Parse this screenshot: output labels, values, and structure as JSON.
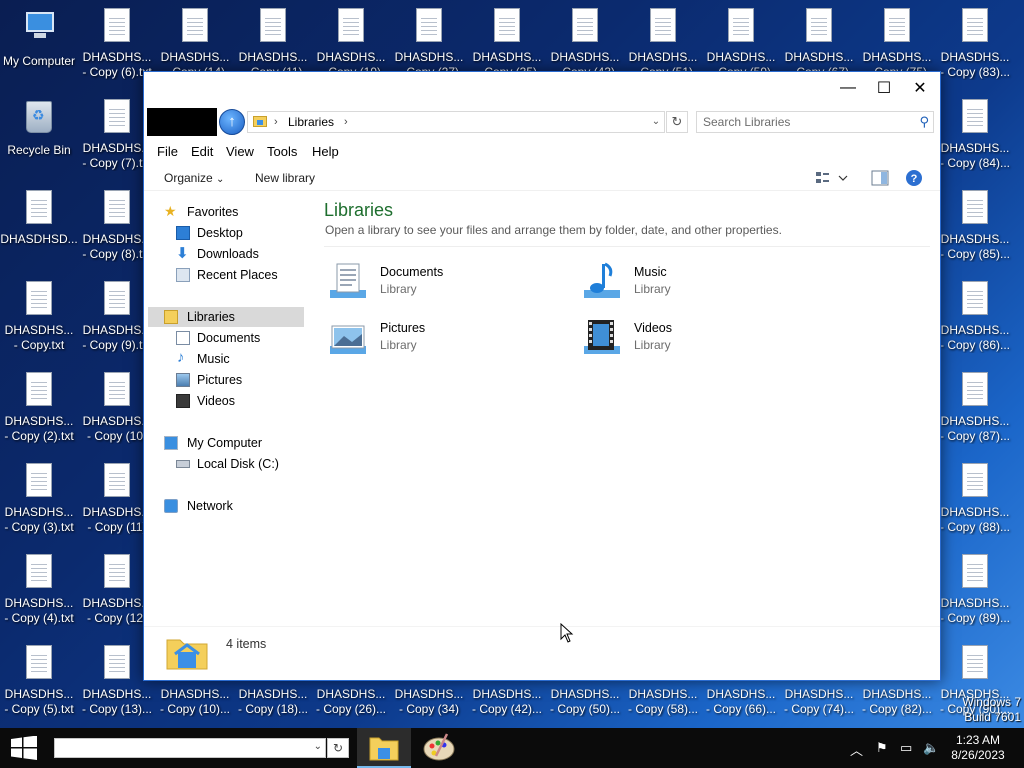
{
  "desktop": {
    "icons": [
      {
        "line1": "My Computer",
        "line2": ""
      },
      {
        "line1": "Recycle Bin",
        "line2": ""
      },
      {
        "line1": "DHASDHSD...",
        "line2": ""
      },
      {
        "line1": "DHASDHS...",
        "line2": "- Copy.txt"
      },
      {
        "line1": "DHASDHS...",
        "line2": "- Copy (2).txt"
      },
      {
        "line1": "DHASDHS...",
        "line2": "- Copy (3).txt"
      },
      {
        "line1": "DHASDHS...",
        "line2": "- Copy (4).txt"
      },
      {
        "line1": "DHASDHS...",
        "line2": "- Copy (5).txt"
      },
      {
        "line1": "DHASDHS...",
        "line2": "- Copy (6).txt"
      },
      {
        "line1": "DHASDHS...",
        "line2": "- Copy (7).txt"
      },
      {
        "line1": "DHASDHS...",
        "line2": "- Copy (8).txt"
      },
      {
        "line1": "DHASDHS...",
        "line2": "- Copy (9).txt"
      },
      {
        "line1": "DHASDHS...",
        "line2": "- Copy (10)"
      },
      {
        "line1": "DHASDHS...",
        "line2": "- Copy (11)"
      },
      {
        "line1": "DHASDHS...",
        "line2": "- Copy (12)"
      },
      {
        "line1": "DHASDHS...",
        "line2": "- Copy (13)..."
      },
      {
        "line1": "DHASDHS...",
        "line2": "- Copy (14)"
      },
      {
        "line1": "DHASDHS...",
        "line2": "- Copy (11)"
      },
      {
        "line1": "DHASDHS...",
        "line2": "- Copy (19)"
      },
      {
        "line1": "DHASDHS...",
        "line2": "- Copy (27)"
      },
      {
        "line1": "DHASDHS...",
        "line2": "- Copy (35)"
      },
      {
        "line1": "DHASDHS...",
        "line2": "- Copy (43)"
      },
      {
        "line1": "DHASDHS...",
        "line2": "- Copy (51)"
      },
      {
        "line1": "DHASDHS...",
        "line2": "- Copy (59)"
      },
      {
        "line1": "DHASDHS...",
        "line2": "- Copy (67)"
      },
      {
        "line1": "DHASDHS...",
        "line2": "- Copy (75)"
      },
      {
        "line1": "DHASDHS...",
        "line2": "- Copy (83)..."
      },
      {
        "line1": "DHASDHS...",
        "line2": "- Copy (84)..."
      },
      {
        "line1": "DHASDHS...",
        "line2": "- Copy (85)..."
      },
      {
        "line1": "DHASDHS...",
        "line2": "- Copy (86)..."
      },
      {
        "line1": "DHASDHS...",
        "line2": "- Copy (87)..."
      },
      {
        "line1": "DHASDHS...",
        "line2": "- Copy (88)..."
      },
      {
        "line1": "DHASDHS...",
        "line2": "- Copy (89)..."
      },
      {
        "line1": "DHASDHS...",
        "line2": "- Copy (10)..."
      },
      {
        "line1": "DHASDHS...",
        "line2": "- Copy (18)..."
      },
      {
        "line1": "DHASDHS...",
        "line2": "- Copy (26)..."
      },
      {
        "line1": "DHASDHS...",
        "line2": "- Copy (34)"
      },
      {
        "line1": "DHASDHS...",
        "line2": "- Copy (42)..."
      },
      {
        "line1": "DHASDHS...",
        "line2": "- Copy (50)..."
      },
      {
        "line1": "DHASDHS...",
        "line2": "- Copy (58)..."
      },
      {
        "line1": "DHASDHS...",
        "line2": "- Copy (66)..."
      },
      {
        "line1": "DHASDHS...",
        "line2": "- Copy (74)..."
      },
      {
        "line1": "DHASDHS...",
        "line2": "- Copy (82)..."
      },
      {
        "line1": "DHASDHS...",
        "line2": "- Copy (90)..."
      }
    ],
    "watermark": {
      "line1": "Windows 7",
      "line2": "Build 7601"
    }
  },
  "window": {
    "controls": {
      "minimize": "—",
      "maximize": "☐",
      "close": "✕"
    },
    "address": {
      "crumb": "Libraries",
      "separator": "›"
    },
    "search": {
      "placeholder": "Search Libraries"
    },
    "menu": [
      "File",
      "Edit",
      "View",
      "Tools",
      "Help"
    ],
    "commands": {
      "organize": "Organize",
      "organize_caret": "⌄",
      "new_library": "New library"
    },
    "nav": {
      "favorites": "Favorites",
      "desktop": "Desktop",
      "downloads": "Downloads",
      "recent": "Recent Places",
      "libraries": "Libraries",
      "documents": "Documents",
      "music": "Music",
      "pictures": "Pictures",
      "videos": "Videos",
      "computer": "My Computer",
      "localdisk": "Local Disk (C:)",
      "network": "Network"
    },
    "content": {
      "title": "Libraries",
      "subtitle": "Open a library to see your files and arrange them by folder, date, and other properties.",
      "libraries": [
        {
          "name": "Documents",
          "type": "Library",
          "icon": "documents-library-icon"
        },
        {
          "name": "Music",
          "type": "Library",
          "icon": "music-library-icon"
        },
        {
          "name": "Pictures",
          "type": "Library",
          "icon": "pictures-library-icon"
        },
        {
          "name": "Videos",
          "type": "Library",
          "icon": "videos-library-icon"
        }
      ]
    },
    "status": {
      "count": "4 items"
    }
  },
  "taskbar": {
    "clock": {
      "time": "1:23 AM",
      "date": "8/26/2023"
    },
    "apps": [
      "file-explorer",
      "paint"
    ]
  },
  "colors": {
    "content_title": "#1e6e2e",
    "selection": "#d9d9d9",
    "taskbar": "#0b0b0b"
  }
}
